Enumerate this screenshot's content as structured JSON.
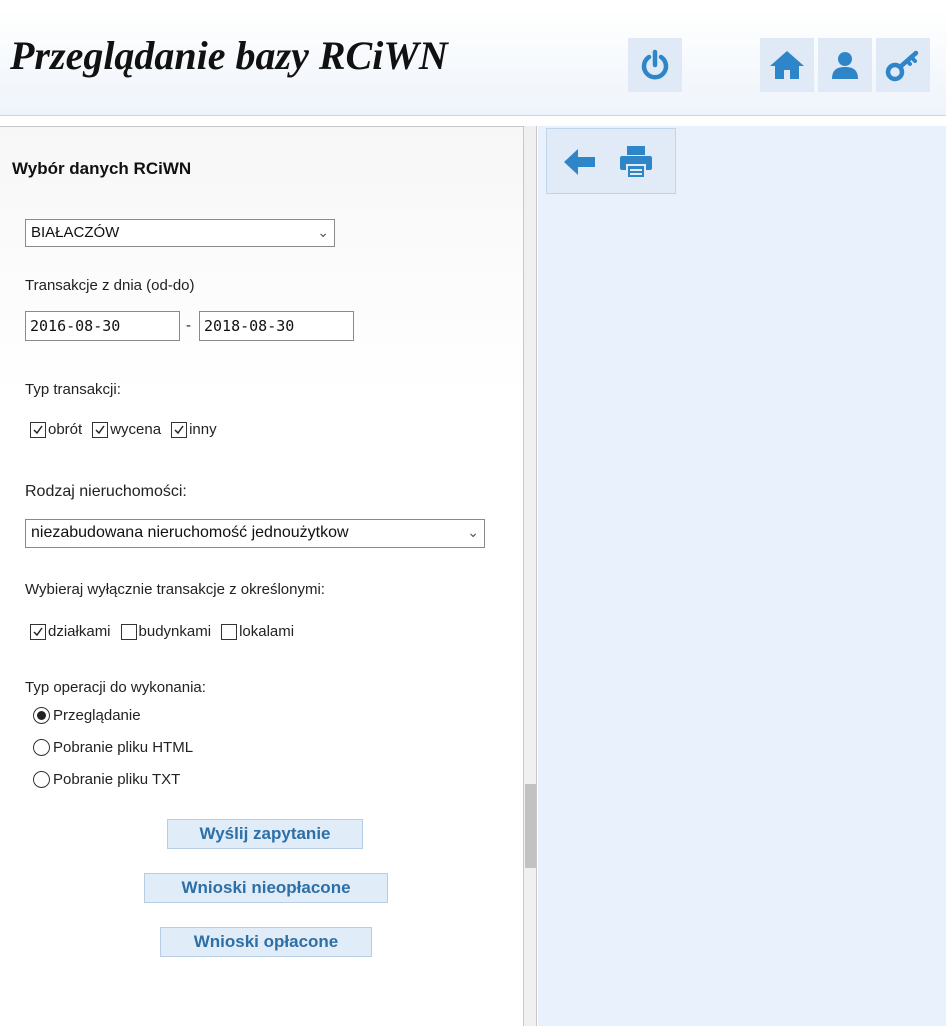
{
  "header": {
    "title": "Przeglądanie bazy RCiWN",
    "icons": [
      "power-icon",
      "home-icon",
      "user-icon",
      "key-icon"
    ],
    "icon_color": "#2e86c8"
  },
  "form": {
    "panel_title": "Wybór danych RCiWN",
    "municipality": {
      "selected": "BIAŁACZÓW"
    },
    "date_range": {
      "label": "Transakcje z dnia (od-do)",
      "from": "2016-08-30",
      "separator": "-",
      "to": "2018-08-30"
    },
    "transaction_type": {
      "label": "Typ transakcji:",
      "options": [
        {
          "label": "obrót",
          "checked": true
        },
        {
          "label": "wycena",
          "checked": true
        },
        {
          "label": "inny",
          "checked": true
        }
      ]
    },
    "property_kind": {
      "label": "Rodzaj nieruchomości:",
      "selected": "niezabudowana nieruchomość jednoużytkow"
    },
    "filter": {
      "label": "Wybieraj wyłącznie transakcje z określonymi:",
      "options": [
        {
          "label": "działkami",
          "checked": true
        },
        {
          "label": "budynkami",
          "checked": false
        },
        {
          "label": "lokalami",
          "checked": false
        }
      ]
    },
    "operation": {
      "label": "Typ operacji do wykonania:",
      "options": [
        {
          "label": "Przeglądanie",
          "selected": true
        },
        {
          "label": "Pobranie pliku HTML",
          "selected": false
        },
        {
          "label": "Pobranie pliku TXT",
          "selected": false
        }
      ]
    },
    "buttons": {
      "send": "Wyślij zapytanie",
      "unpaid": "Wnioski nieopłacone",
      "paid": "Wnioski opłacone"
    }
  },
  "toolbar": {
    "icons": [
      "back-arrow-icon",
      "print-icon"
    ]
  }
}
